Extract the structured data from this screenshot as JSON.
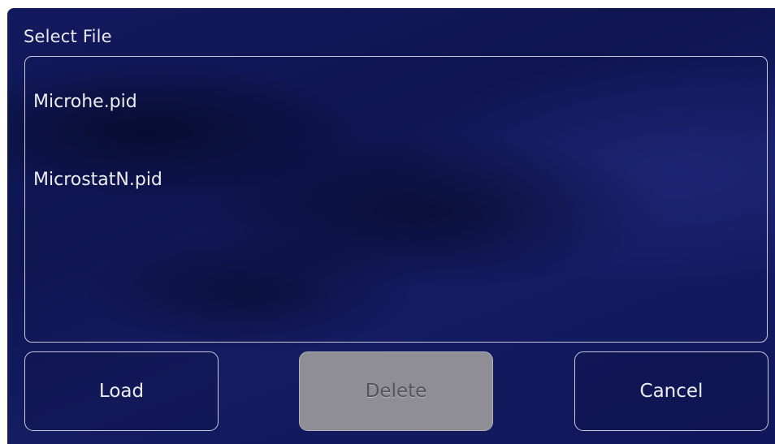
{
  "dialog": {
    "title": "Select File"
  },
  "files": [
    {
      "name": "Microhe.pid"
    },
    {
      "name": "MicrostatN.pid"
    }
  ],
  "buttons": {
    "load_label": "Load",
    "delete_label": "Delete",
    "delete_state": "disabled",
    "cancel_label": "Cancel"
  },
  "colors": {
    "background": "#0e1550",
    "border": "#c8cadb",
    "text": "#ececf2",
    "disabled_button_bg": "#8e8e94",
    "disabled_button_text": "#54545a"
  }
}
